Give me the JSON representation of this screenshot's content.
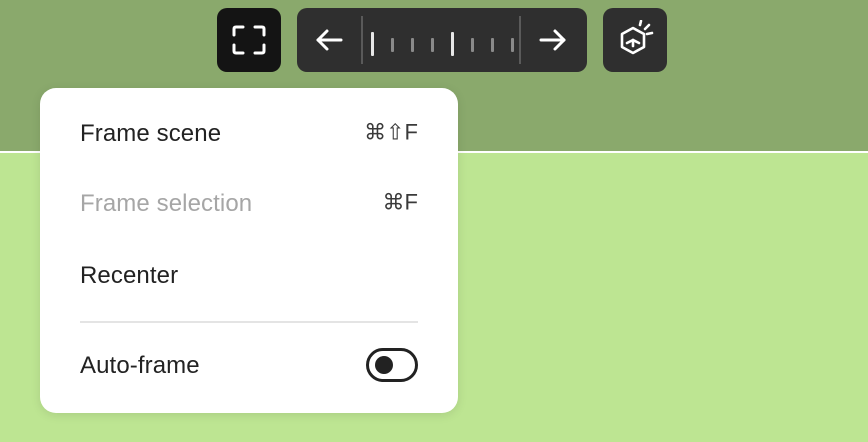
{
  "toolbar": {
    "frame_button": {
      "icon": "frame-corners-icon",
      "state": "active"
    },
    "scrubber": {
      "left_icon": "arrow-left-icon",
      "right_icon": "arrow-right-icon"
    },
    "view_button": {
      "icon": "cube-view-icon"
    }
  },
  "menu": {
    "items": [
      {
        "label": "Frame scene",
        "shortcut": "⌘⇧F",
        "enabled": true
      },
      {
        "label": "Frame selection",
        "shortcut": "⌘F",
        "enabled": false
      },
      {
        "label": "Recenter",
        "shortcut": "",
        "enabled": true
      }
    ],
    "auto_frame": {
      "label": "Auto-frame",
      "on": false
    }
  },
  "colors": {
    "sky": "#8aa96c",
    "ground": "#bde592",
    "toolbar": "#2f2f2f",
    "active_button": "#141414",
    "disabled_text": "#a6a6a6"
  }
}
